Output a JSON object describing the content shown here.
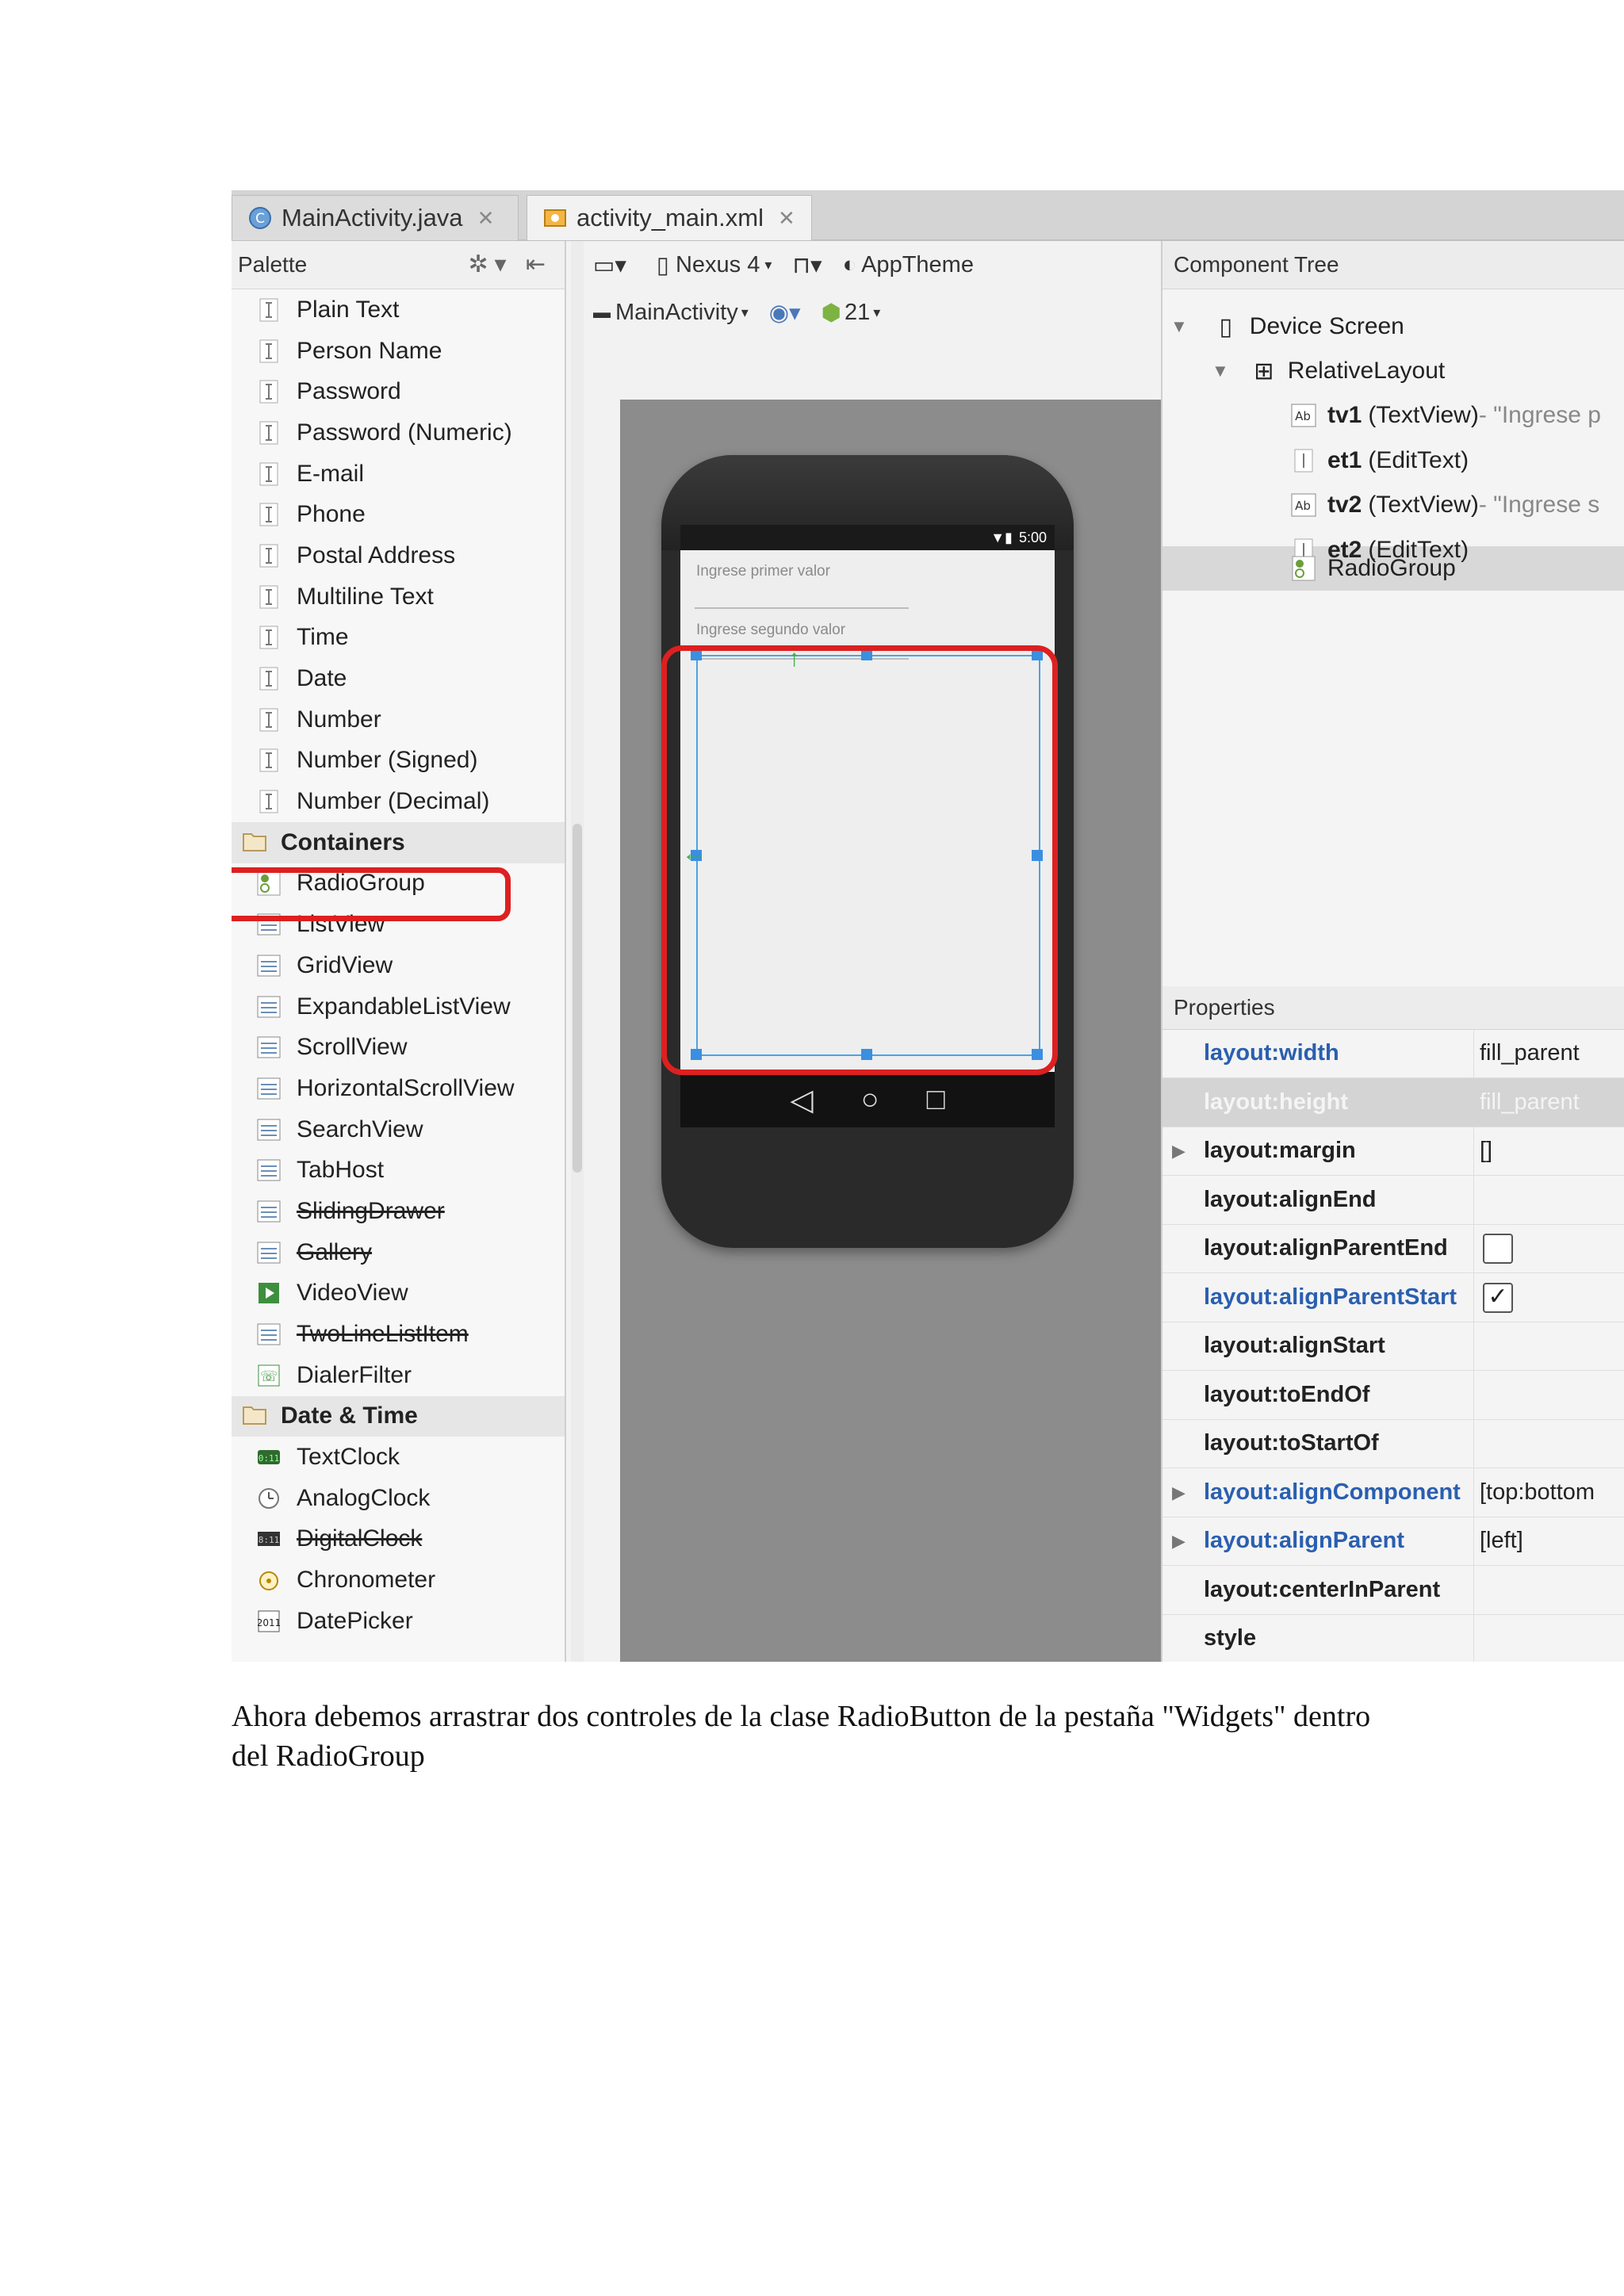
{
  "tabs": [
    {
      "label": "MainActivity.java",
      "icon": "java-class-icon"
    },
    {
      "label": "activity_main.xml",
      "icon": "xml-layout-icon"
    }
  ],
  "palette": {
    "title": "Palette",
    "text_fields": [
      "Plain Text",
      "Person Name",
      "Password",
      "Password (Numeric)",
      "E-mail",
      "Phone",
      "Postal Address",
      "Multiline Text",
      "Time",
      "Date",
      "Number",
      "Number (Signed)",
      "Number (Decimal)"
    ],
    "containers_label": "Containers",
    "containers": [
      {
        "label": "RadioGroup",
        "icon": "radiogroup-icon"
      },
      {
        "label": "ListView",
        "icon": "listview-icon"
      },
      {
        "label": "GridView",
        "icon": "gridview-icon"
      },
      {
        "label": "ExpandableListView",
        "icon": "expandable-list-icon"
      },
      {
        "label": "ScrollView",
        "icon": "scrollview-icon"
      },
      {
        "label": "HorizontalScrollView",
        "icon": "horizontal-scroll-icon"
      },
      {
        "label": "SearchView",
        "icon": "search-icon"
      },
      {
        "label": "TabHost",
        "icon": "tabhost-icon"
      },
      {
        "label": "SlidingDrawer",
        "icon": "sliding-drawer-icon",
        "deprecated": true
      },
      {
        "label": "Gallery",
        "icon": "gallery-icon",
        "deprecated": true
      },
      {
        "label": "VideoView",
        "icon": "video-icon"
      },
      {
        "label": "TwoLineListItem",
        "icon": "two-line-list-icon",
        "deprecated": true
      },
      {
        "label": "DialerFilter",
        "icon": "phone-icon"
      }
    ],
    "datetime_label": "Date & Time",
    "datetime": [
      {
        "label": "TextClock",
        "icon": "text-clock-icon"
      },
      {
        "label": "AnalogClock",
        "icon": "analog-clock-icon"
      },
      {
        "label": "DigitalClock",
        "icon": "digital-clock-icon",
        "deprecated": true
      },
      {
        "label": "Chronometer",
        "icon": "chronometer-icon"
      },
      {
        "label": "DatePicker",
        "icon": "date-picker-icon"
      }
    ]
  },
  "toolbar": {
    "device": "Nexus 4",
    "theme": "AppTheme",
    "activity": "MainActivity",
    "api": "21"
  },
  "device_preview": {
    "status_time": "5:00",
    "hint1": "Ingrese primer valor",
    "hint2": "Ingrese segundo valor"
  },
  "component_tree": {
    "title": "Component Tree",
    "device_screen": "Device Screen",
    "layout": "RelativeLayout",
    "nodes": [
      {
        "id": "tv1",
        "type": "(TextView)",
        "suffix": " - \"Ingrese p",
        "icon": "textview-icon"
      },
      {
        "id": "et1",
        "type": "(EditText)",
        "suffix": "",
        "icon": "edittext-icon"
      },
      {
        "id": "tv2",
        "type": "(TextView)",
        "suffix": " - \"Ingrese s",
        "icon": "textview-icon"
      },
      {
        "id": "et2",
        "type": "(EditText)",
        "suffix": "",
        "icon": "edittext-icon"
      }
    ],
    "selected": "RadioGroup"
  },
  "properties": {
    "title": "Properties",
    "rows": [
      {
        "name": "layout:width",
        "value": "fill_parent",
        "blue": true
      },
      {
        "name": "layout:height",
        "value": "fill_parent",
        "blue": true,
        "selected": true
      },
      {
        "name": "layout:margin",
        "value": "[]",
        "expandable": true
      },
      {
        "name": "layout:alignEnd",
        "value": ""
      },
      {
        "name": "layout:alignParentEnd",
        "value": "",
        "checkbox": "unchecked"
      },
      {
        "name": "layout:alignParentStart",
        "value": "",
        "checkbox": "checked",
        "blue": true
      },
      {
        "name": "layout:alignStart",
        "value": ""
      },
      {
        "name": "layout:toEndOf",
        "value": ""
      },
      {
        "name": "layout:toStartOf",
        "value": ""
      },
      {
        "name": "layout:alignComponent",
        "value": "[top:bottom",
        "blue": true,
        "expandable": true
      },
      {
        "name": "layout:alignParent",
        "value": "[left]",
        "blue": true,
        "expandable": true
      },
      {
        "name": "layout:centerInParent",
        "value": ""
      },
      {
        "name": "style",
        "value": ""
      }
    ]
  },
  "caption": "Ahora debemos arrastrar dos controles de la clase RadioButton de la pestaña \"Widgets\" dentro del RadioGroup",
  "colors": {
    "highlight_red": "#dd2020",
    "selection_blue": "#4aa3e8",
    "property_blue": "#2a5fb0"
  }
}
